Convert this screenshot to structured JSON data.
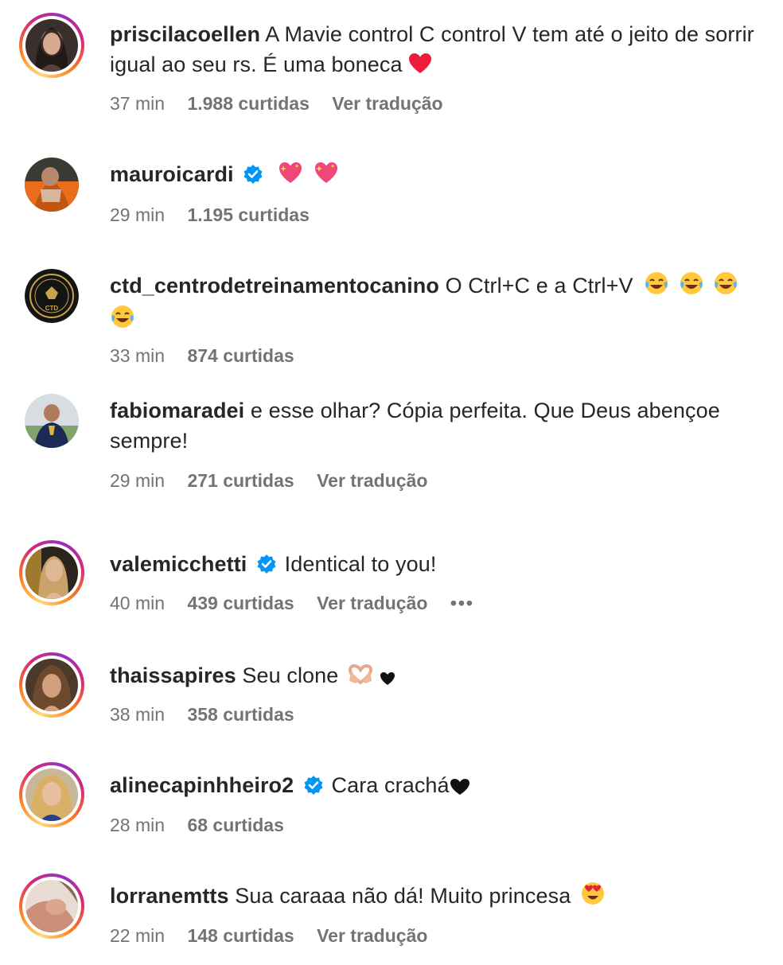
{
  "comments": [
    {
      "username": "priscilacoellen",
      "verified": false,
      "text": "A Mavie control C control V tem até o jeito de sorrir igual ao seu rs. É uma boneca",
      "emoji": "red-heart",
      "time": "37 min",
      "likes": "1.988 curtidas",
      "translate": "Ver tradução"
    },
    {
      "username": "mauroicardi",
      "verified": true,
      "text": "",
      "emoji": "sparkling-heart x2",
      "time": "29 min",
      "likes": "1.195 curtidas"
    },
    {
      "username": "ctd_centrodetreinamentocanino",
      "verified": false,
      "text": "O Ctrl+C e a Ctrl+V",
      "emoji": "tears-of-joy x4",
      "time": "33 min",
      "likes": "874 curtidas"
    },
    {
      "username": "fabiomaradei",
      "verified": false,
      "text": "e esse olhar? Cópia perfeita. Que Deus abençoe sempre!",
      "time": "29 min",
      "likes": "271 curtidas",
      "translate": "Ver tradução"
    },
    {
      "username": "valemicchetti",
      "verified": true,
      "text": "Identical to you!",
      "time": "40 min",
      "likes": "439 curtidas",
      "translate": "Ver tradução",
      "more": "•••"
    },
    {
      "username": "thaissapires",
      "verified": false,
      "text": "Seu clone",
      "emoji": "heart-hands, black-heart",
      "time": "38 min",
      "likes": "358 curtidas"
    },
    {
      "username": "alinecapinhheiro2",
      "verified": true,
      "text": "Cara crachá",
      "emoji": "black-heart",
      "time": "28 min",
      "likes": "68 curtidas"
    },
    {
      "username": "lorranemtts",
      "verified": false,
      "text": "Sua caraaa não dá! Muito princesa",
      "emoji": "heart-eyes",
      "time": "22 min",
      "likes": "148 curtidas",
      "translate": "Ver tradução"
    }
  ],
  "colors": {
    "text": "#262626",
    "meta": "#737373",
    "verified": "#0095f6",
    "heart": "#ed1c3a"
  }
}
